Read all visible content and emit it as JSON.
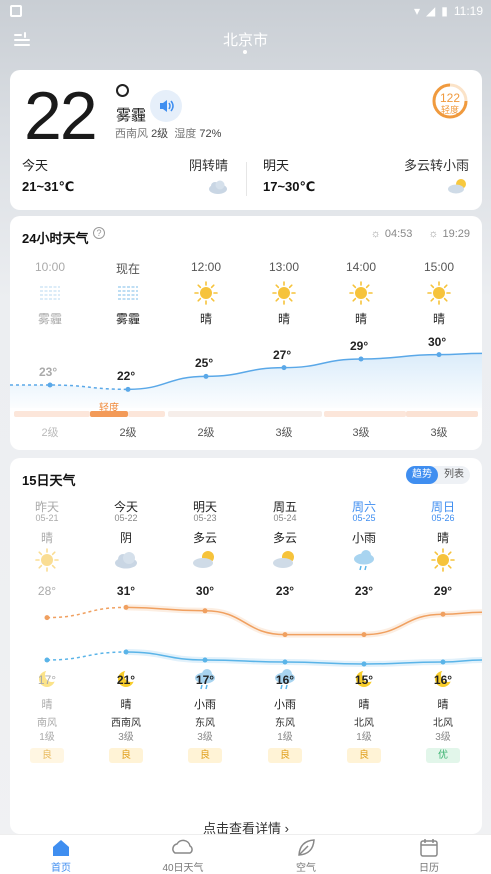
{
  "status_bar": {
    "time": "11:19"
  },
  "header": {
    "city": "北京市"
  },
  "now": {
    "temp": "22",
    "condition": "雾霾",
    "wind_dir": "西南风",
    "wind_level": "2级",
    "humidity_label": "湿度",
    "humidity": "72%",
    "aqi_value": "122",
    "aqi_level": "轻度",
    "aqi_color": "#f09a3e"
  },
  "today": {
    "label": "今天",
    "condition": "阴转晴",
    "range": "21~31℃"
  },
  "tomorrow": {
    "label": "明天",
    "condition": "多云转小雨",
    "range": "17~30℃"
  },
  "hourly": {
    "title": "24小时天气",
    "sunrise": "04:53",
    "sunset": "19:29",
    "aqi_tag": "轻度",
    "hours": [
      {
        "time": "10:00",
        "icon": "haze-icon",
        "condition": "雾霾",
        "temp": "23°",
        "wind": "2级"
      },
      {
        "time": "现在",
        "icon": "haze-icon",
        "condition": "雾霾",
        "temp": "22°",
        "wind": "2级"
      },
      {
        "time": "12:00",
        "icon": "sun-icon",
        "condition": "晴",
        "temp": "25°",
        "wind": "2级"
      },
      {
        "time": "13:00",
        "icon": "sun-icon",
        "condition": "晴",
        "temp": "27°",
        "wind": "3级"
      },
      {
        "time": "14:00",
        "icon": "sun-icon",
        "condition": "晴",
        "temp": "29°",
        "wind": "3级"
      },
      {
        "time": "15:00",
        "icon": "sun-icon",
        "condition": "晴",
        "temp": "30°",
        "wind": "3级"
      }
    ]
  },
  "forecast": {
    "title": "15日天气",
    "toggle_on": "趋势",
    "toggle_off": "列表",
    "detail_link": "点击查看详情 ›",
    "days": [
      {
        "week": "昨天",
        "date": "05-21",
        "day_cond": "晴",
        "day_icon": "sun-icon",
        "hi": "28°",
        "lo": "17°",
        "night_icon": "moon-icon",
        "night_cond": "晴",
        "wind_dir": "南风",
        "wind_lvl": "1级",
        "air": "良"
      },
      {
        "week": "今天",
        "date": "05-22",
        "day_cond": "阴",
        "day_icon": "cloud-icon",
        "hi": "31°",
        "lo": "21°",
        "night_icon": "moon-icon",
        "night_cond": "晴",
        "wind_dir": "西南风",
        "wind_lvl": "3级",
        "air": "良"
      },
      {
        "week": "明天",
        "date": "05-23",
        "day_cond": "多云",
        "day_icon": "partly-cloudy-icon",
        "hi": "30°",
        "lo": "17°",
        "night_icon": "rain-icon",
        "night_cond": "小雨",
        "wind_dir": "东风",
        "wind_lvl": "3级",
        "air": "良"
      },
      {
        "week": "周五",
        "date": "05-24",
        "day_cond": "多云",
        "day_icon": "partly-cloudy-icon",
        "hi": "23°",
        "lo": "16°",
        "night_icon": "rain-icon",
        "night_cond": "小雨",
        "wind_dir": "东风",
        "wind_lvl": "1级",
        "air": "良"
      },
      {
        "week": "周六",
        "date": "05-25",
        "day_cond": "小雨",
        "day_icon": "rain-icon",
        "hi": "23°",
        "lo": "15°",
        "night_icon": "moon-icon",
        "night_cond": "晴",
        "wind_dir": "北风",
        "wind_lvl": "1级",
        "air": "良"
      },
      {
        "week": "周日",
        "date": "05-26",
        "day_cond": "晴",
        "day_icon": "sun-icon",
        "hi": "29°",
        "lo": "16°",
        "night_icon": "moon-icon",
        "night_cond": "晴",
        "wind_dir": "北风",
        "wind_lvl": "3级",
        "air": "优"
      }
    ]
  },
  "tabs": [
    {
      "label": "首页",
      "icon": "home-icon"
    },
    {
      "label": "40日天气",
      "icon": "cloud-icon"
    },
    {
      "label": "空气",
      "icon": "leaf-icon"
    },
    {
      "label": "日历",
      "icon": "calendar-icon"
    }
  ],
  "colors": {
    "accent": "#3f8ef0",
    "high_line": "#f0a060",
    "low_line": "#5ab4e8",
    "hourly_line": "#5aa8e8"
  }
}
